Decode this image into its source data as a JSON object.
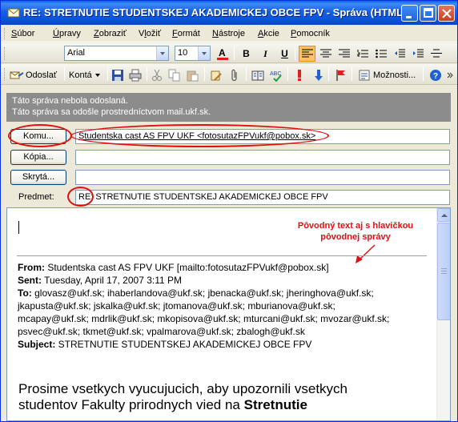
{
  "window": {
    "title": "RE: STRETNUTIE STUDENTSKEJ AKADEMICKEJ OBCE FPV - Správa (HTML)"
  },
  "menu": {
    "items": [
      {
        "pre": "",
        "u": "S",
        "post": "úbor"
      },
      {
        "pre": "",
        "u": "Ú",
        "post": "pravy"
      },
      {
        "pre": "",
        "u": "Z",
        "post": "obraziť"
      },
      {
        "pre": "V",
        "u": "l",
        "post": "ožiť"
      },
      {
        "pre": "",
        "u": "F",
        "post": "ormát"
      },
      {
        "pre": "",
        "u": "N",
        "post": "ástroje"
      },
      {
        "pre": "",
        "u": "A",
        "post": "kcie"
      },
      {
        "pre": "",
        "u": "P",
        "post": "omocník"
      }
    ]
  },
  "format": {
    "font": "Arial",
    "size": "10",
    "bold": "B",
    "italic": "I",
    "underline": "U"
  },
  "toolbar": {
    "send": "Odoslať",
    "accounts": "Kontá",
    "options": "Možnosti..."
  },
  "info": {
    "line1": "Táto správa nebola odoslaná.",
    "line2": "Táto správa sa odošle prostredníctvom mail.ukf.sk."
  },
  "fields": {
    "to_btn": "Komu...",
    "to_value": "Studentska cast AS FPV UKF <fotosutazFPVukf@pobox.sk>",
    "cc_btn": "Kópia...",
    "cc_value": "",
    "bcc_btn": "Skrytá...",
    "bcc_value": "",
    "subject_label": "Predmet:",
    "subject_prefix": "RE:",
    "subject_value": " STRETNUTIE STUDENTSKEJ AKADEMICKEJ OBCE FPV"
  },
  "annotation": {
    "line1": "Pôvodný text aj s hlavičkou",
    "line2": "pôvodnej správy"
  },
  "quoted": {
    "from_label": "From:",
    "from": " Studentska cast AS FPV UKF [mailto:fotosutazFPVukf@pobox.sk]",
    "sent_label": "Sent:",
    "sent": " Tuesday, April 17, 2007 3:11 PM",
    "to_label": "To:",
    "to_1": " glovasz@ukf.sk; ihaberlandova@ukf.sk; jbenacka@ukf.sk; jheringhova@ukf.sk;",
    "to_2": "jkapusta@ukf.sk; jskalka@ukf.sk; jtomanova@ukf.sk; mburianova@ukf.sk;",
    "to_3": "mcapay@ukf.sk; mdrlik@ukf.sk; mkopisova@ukf.sk; mturcani@ukf.sk; mvozar@ukf.sk;",
    "to_4": "psvec@ukf.sk; tkmet@ukf.sk; vpalmarova@ukf.sk; zbalogh@ukf.sk",
    "subject_label": "Subject:",
    "subject": " STRETNUTIE STUDENTSKEJ AKADEMICKEJ OBCE FPV",
    "body_1": "Prosime vsetkych vyucujucich, aby upozornili vsetkych",
    "body_2a": "studentov Fakulty prirodnych vied na ",
    "body_2b": "Stretnutie"
  }
}
